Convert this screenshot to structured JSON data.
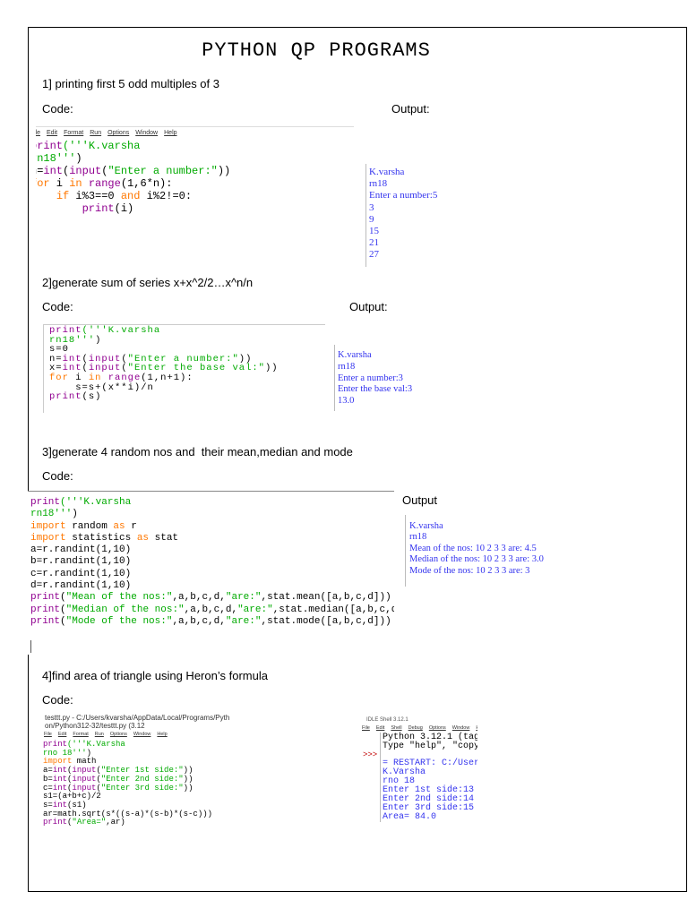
{
  "title": "PYTHON QP PROGRAMS",
  "labels": {
    "code": "Code:",
    "output": "Output:",
    "output3": "Output"
  },
  "q1": {
    "heading": "1] printing first 5 odd multiples of 3",
    "menu": [
      "ile",
      "Edit",
      "Format",
      "Run",
      "Options",
      "Window",
      "Help"
    ],
    "code": [
      [
        [
          "print",
          "bi"
        ],
        [
          "('''K.varsha",
          "str"
        ]
      ],
      [
        [
          "rn18'''",
          "str"
        ],
        [
          ")",
          "pl"
        ]
      ],
      [
        [
          "n=",
          "pl"
        ],
        [
          "int",
          "bi"
        ],
        [
          "(",
          "pl"
        ],
        [
          "input",
          "bi"
        ],
        [
          "(",
          "pl"
        ],
        [
          "\"Enter a number:\"",
          "str"
        ],
        [
          "))",
          "pl"
        ]
      ],
      [
        [
          "for",
          "kw"
        ],
        [
          " i ",
          "pl"
        ],
        [
          "in",
          "kw"
        ],
        [
          " ",
          "pl"
        ],
        [
          "range",
          "bi"
        ],
        [
          "(1,6*n):",
          "pl"
        ]
      ],
      [
        [
          "    ",
          "pl"
        ],
        [
          "if",
          "kw"
        ],
        [
          " i%3==0 ",
          "pl"
        ],
        [
          "and",
          "kw"
        ],
        [
          " i%2!=0:",
          "pl"
        ]
      ],
      [
        [
          "        ",
          "pl"
        ],
        [
          "print",
          "bi"
        ],
        [
          "(i)",
          "pl"
        ]
      ]
    ],
    "output": [
      "K.varsha",
      "rn18",
      "Enter a number:5",
      "3",
      "9",
      "15",
      "21",
      "27"
    ]
  },
  "q2": {
    "heading": "2]generate sum of series x+x^2/2…x^n/n",
    "code": [
      [
        [
          "print",
          "bi"
        ],
        [
          "('''K.varsha",
          "str"
        ]
      ],
      [
        [
          "rn18'''",
          "str"
        ],
        [
          ")",
          "pl"
        ]
      ],
      [
        [
          "s=0",
          "pl"
        ]
      ],
      [
        [
          "n=",
          "pl"
        ],
        [
          "int",
          "bi"
        ],
        [
          "(",
          "pl"
        ],
        [
          "input",
          "bi"
        ],
        [
          "(",
          "pl"
        ],
        [
          "\"Enter a number:\"",
          "str"
        ],
        [
          "))",
          "pl"
        ]
      ],
      [
        [
          "x=",
          "pl"
        ],
        [
          "int",
          "bi"
        ],
        [
          "(",
          "pl"
        ],
        [
          "input",
          "bi"
        ],
        [
          "(",
          "pl"
        ],
        [
          "\"Enter the base val:\"",
          "str"
        ],
        [
          "))",
          "pl"
        ]
      ],
      [
        [
          "for",
          "kw"
        ],
        [
          " i ",
          "pl"
        ],
        [
          "in",
          "kw"
        ],
        [
          " ",
          "pl"
        ],
        [
          "range",
          "bi"
        ],
        [
          "(1,n+1):",
          "pl"
        ]
      ],
      [
        [
          "    s=s+(x**i)/n",
          "pl"
        ]
      ],
      [
        [
          "print",
          "bi"
        ],
        [
          "(s)",
          "pl"
        ]
      ]
    ],
    "output": [
      "K.varsha",
      "rn18",
      "Enter a number:3",
      "Enter the base val:3",
      "13.0"
    ]
  },
  "q3": {
    "heading": "3]generate 4 random nos and  their mean,median and mode",
    "code": [
      [
        [
          "print",
          "bi"
        ],
        [
          "('''K.varsha",
          "str"
        ]
      ],
      [
        [
          "rn18'''",
          "str"
        ],
        [
          ")",
          "pl"
        ]
      ],
      [
        [
          "import",
          "kw"
        ],
        [
          " random ",
          "pl"
        ],
        [
          "as",
          "kw"
        ],
        [
          " r",
          "pl"
        ]
      ],
      [
        [
          "import",
          "kw"
        ],
        [
          " statistics ",
          "pl"
        ],
        [
          "as",
          "kw"
        ],
        [
          " stat",
          "pl"
        ]
      ],
      [
        [
          "a=r.randint(1,10)",
          "pl"
        ]
      ],
      [
        [
          "b=r.randint(1,10)",
          "pl"
        ]
      ],
      [
        [
          "c=r.randint(1,10)",
          "pl"
        ]
      ],
      [
        [
          "d=r.randint(1,10)",
          "pl"
        ]
      ],
      [
        [
          "print",
          "bi"
        ],
        [
          "(",
          "pl"
        ],
        [
          "\"Mean of the nos:\"",
          "str"
        ],
        [
          ",a,b,c,d,",
          "pl"
        ],
        [
          "\"are:\"",
          "str"
        ],
        [
          ",stat.mean([a,b,c,d]))",
          "pl"
        ]
      ],
      [
        [
          "print",
          "bi"
        ],
        [
          "(",
          "pl"
        ],
        [
          "\"Median of the nos:\"",
          "str"
        ],
        [
          ",a,b,c,d,",
          "pl"
        ],
        [
          "\"are:\"",
          "str"
        ],
        [
          ",stat.median([a,b,c,d]))",
          "pl"
        ]
      ],
      [
        [
          "print",
          "bi"
        ],
        [
          "(",
          "pl"
        ],
        [
          "\"Mode of the nos:\"",
          "str"
        ],
        [
          ",a,b,c,d,",
          "pl"
        ],
        [
          "\"are:\"",
          "str"
        ],
        [
          ",stat.mode([a,b,c,d]))",
          "pl"
        ]
      ]
    ],
    "output": [
      "K.varsha",
      "rn18",
      "Mean of the nos: 10 2 3 3 are: 4.5",
      "Median of the nos: 10 2 3 3 are: 3.0",
      "Mode of the nos: 10 2 3 3 are: 3"
    ]
  },
  "q4": {
    "heading": "4]find area of triangle using Heron’s formula",
    "editor_title": "testtt.py - C:/Users/kvarsha/AppData/Local/Programs/Python/Python312-32/testtt.py (3.12",
    "menu": [
      "File",
      "Edit",
      "Format",
      "Run",
      "Options",
      "Window",
      "Help"
    ],
    "code": [
      [
        [
          "print",
          "bi"
        ],
        [
          "('''K.Varsha",
          "str"
        ]
      ],
      [
        [
          "rno 18'''",
          "str"
        ],
        [
          ")",
          "pl"
        ]
      ],
      [
        [
          "import",
          "kw"
        ],
        [
          " math",
          "pl"
        ]
      ],
      [
        [
          "a=",
          "pl"
        ],
        [
          "int",
          "bi"
        ],
        [
          "(",
          "pl"
        ],
        [
          "input",
          "bi"
        ],
        [
          "(",
          "pl"
        ],
        [
          "\"Enter 1st side:\"",
          "str"
        ],
        [
          "))",
          "pl"
        ]
      ],
      [
        [
          "b=",
          "pl"
        ],
        [
          "int",
          "bi"
        ],
        [
          "(",
          "pl"
        ],
        [
          "input",
          "bi"
        ],
        [
          "(",
          "pl"
        ],
        [
          "\"Enter 2nd side:\"",
          "str"
        ],
        [
          "))",
          "pl"
        ]
      ],
      [
        [
          "c=",
          "pl"
        ],
        [
          "int",
          "bi"
        ],
        [
          "(",
          "pl"
        ],
        [
          "input",
          "bi"
        ],
        [
          "(",
          "pl"
        ],
        [
          "\"Enter 3rd side:\"",
          "str"
        ],
        [
          "))",
          "pl"
        ]
      ],
      [
        [
          "s1=(a+b+c)/2",
          "pl"
        ]
      ],
      [
        [
          "s=",
          "pl"
        ],
        [
          "int",
          "bi"
        ],
        [
          "(s1)",
          "pl"
        ]
      ],
      [
        [
          "ar=math.sqrt(s*((s-a)*(s-b)*(s-c)))",
          "pl"
        ]
      ],
      [
        [
          "print",
          "bi"
        ],
        [
          "(",
          "pl"
        ],
        [
          "\"Area=\"",
          "str"
        ],
        [
          ",ar)",
          "pl"
        ]
      ]
    ],
    "shell_title": "IDLE Shell 3.12.1",
    "shell_menu": [
      "File",
      "Edit",
      "Shell",
      "Debug",
      "Options",
      "Window",
      "He"
    ],
    "shell_prompt": ">>>",
    "shell_header": [
      "Python 3.12.1 (tag",
      "Type \"help\", \"copy"
    ],
    "output": [
      "= RESTART: C:/User",
      "K.Varsha",
      "rno 18",
      "Enter 1st side:13",
      "Enter 2nd side:14",
      "Enter 3rd side:15",
      "Area= 84.0"
    ]
  }
}
